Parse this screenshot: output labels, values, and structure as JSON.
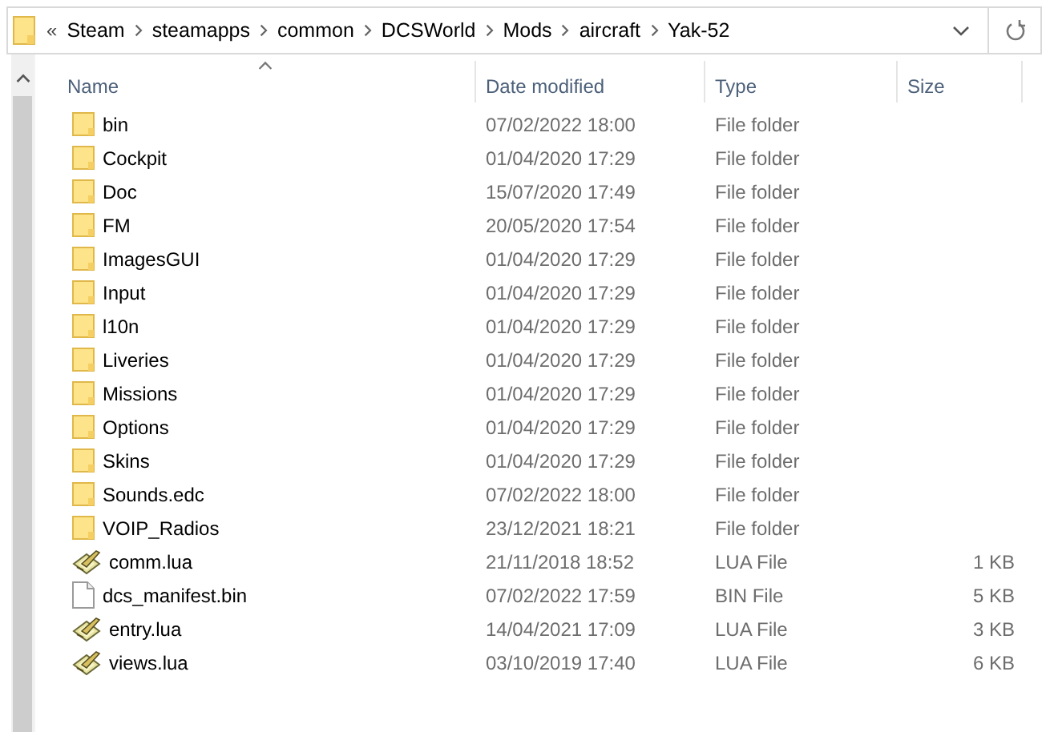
{
  "address_bar": {
    "overflow": "«",
    "crumbs": [
      "Steam",
      "steamapps",
      "common",
      "DCSWorld",
      "Mods",
      "aircraft",
      "Yak-52"
    ]
  },
  "columns": [
    {
      "label": "Name",
      "sorted": true
    },
    {
      "label": "Date modified",
      "sorted": false
    },
    {
      "label": "Type",
      "sorted": false
    },
    {
      "label": "Size",
      "sorted": false
    }
  ],
  "rows": [
    {
      "kind": "folder",
      "name": "bin",
      "date": "07/02/2022 18:00",
      "type": "File folder"
    },
    {
      "kind": "folder",
      "name": "Cockpit",
      "date": "01/04/2020 17:29",
      "type": "File folder"
    },
    {
      "kind": "folder",
      "name": "Doc",
      "date": "15/07/2020 17:49",
      "type": "File folder"
    },
    {
      "kind": "folder",
      "name": "FM",
      "date": "20/05/2020 17:54",
      "type": "File folder"
    },
    {
      "kind": "folder",
      "name": "ImagesGUI",
      "date": "01/04/2020 17:29",
      "type": "File folder"
    },
    {
      "kind": "folder",
      "name": "Input",
      "date": "01/04/2020 17:29",
      "type": "File folder"
    },
    {
      "kind": "folder",
      "name": "l10n",
      "date": "01/04/2020 17:29",
      "type": "File folder"
    },
    {
      "kind": "folder",
      "name": "Liveries",
      "date": "01/04/2020 17:29",
      "type": "File folder"
    },
    {
      "kind": "folder",
      "name": "Missions",
      "date": "01/04/2020 17:29",
      "type": "File folder"
    },
    {
      "kind": "folder",
      "name": "Options",
      "date": "01/04/2020 17:29",
      "type": "File folder"
    },
    {
      "kind": "folder",
      "name": "Skins",
      "date": "01/04/2020 17:29",
      "type": "File folder"
    },
    {
      "kind": "folder",
      "name": "Sounds.edc",
      "date": "07/02/2022 18:00",
      "type": "File folder"
    },
    {
      "kind": "folder",
      "name": "VOIP_Radios",
      "date": "23/12/2021 18:21",
      "type": "File folder"
    },
    {
      "kind": "script",
      "name": "comm.lua",
      "date": "21/11/2018 18:52",
      "type": "LUA File",
      "size": "1 KB"
    },
    {
      "kind": "file",
      "name": "dcs_manifest.bin",
      "date": "07/02/2022 17:59",
      "type": "BIN File",
      "size": "5 KB"
    },
    {
      "kind": "script",
      "name": "entry.lua",
      "date": "14/04/2021 17:09",
      "type": "LUA File",
      "size": "3 KB"
    },
    {
      "kind": "script",
      "name": "views.lua",
      "date": "03/10/2019 17:40",
      "type": "LUA File",
      "size": "6 KB"
    }
  ]
}
